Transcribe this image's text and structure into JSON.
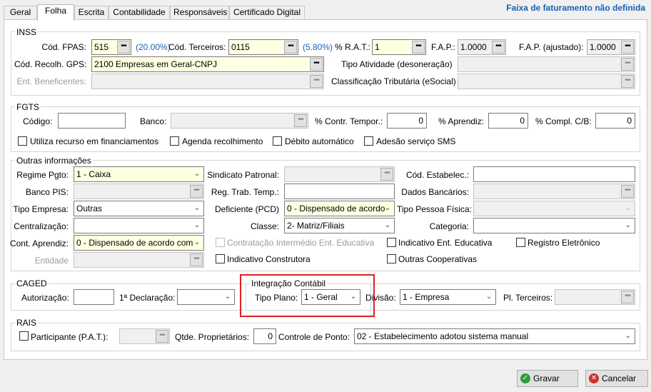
{
  "tabs": [
    "Geral",
    "Folha",
    "Escrita",
    "Contabilidade",
    "Responsáveis",
    "Certificado Digital"
  ],
  "status_title": "Faixa de faturamento não definida",
  "inss": {
    "title": "INSS",
    "fpas_label": "Cód. FPAS:",
    "fpas_value": "515",
    "fpas_pct": "(20.00%)",
    "terceiros_label": "Cód. Terceiros:",
    "terceiros_value": "0115",
    "terceiros_pct": "(5.80%)",
    "rat_label": "% R.A.T.:",
    "rat_value": "1",
    "fap_label": "F.A.P.:",
    "fap_value": "1.0000",
    "fap_aj_label": "F.A.P. (ajustado):",
    "fap_aj_value": "1.0000",
    "gps_label": "Cód. Recolh. GPS:",
    "gps_value": "2100 Empresas em Geral-CNPJ",
    "tipo_atividade_label": "Tipo Atividade (desoneração)",
    "ent_benef_label": "Ent. Beneficentes:",
    "class_trib_label": "Classificação Tributária (eSocial)"
  },
  "fgts": {
    "title": "FGTS",
    "codigo_label": "Código:",
    "banco_label": "Banco:",
    "contr_temp_label": "% Contr. Tempor.:",
    "contr_temp_value": "0",
    "aprendiz_label": "% Aprendiz:",
    "aprendiz_value": "0",
    "compl_label": "% Compl. C/B:",
    "compl_value": "0",
    "cb_financ": "Utiliza recurso em financiamentos",
    "cb_agenda": "Agenda recolhimento",
    "cb_debito": "Débito automático",
    "cb_sms": "Adesão serviço SMS"
  },
  "outras": {
    "title": "Outras informações",
    "regime_label": "Regime Pgto:",
    "regime_value": "1 - Caixa",
    "sindicato_label": "Sindicato Patronal:",
    "estab_label": "Cód. Estabelec.:",
    "banco_pis_label": "Banco PIS:",
    "reg_trab_label": "Reg. Trab. Temp.:",
    "dados_banc_label": "Dados Bancários:",
    "tipo_emp_label": "Tipo Empresa:",
    "tipo_emp_value": "Outras",
    "deficiente_label": "Deficiente (PCD)",
    "deficiente_value": "0 - Dispensado de acordo",
    "tipo_pf_label": "Tipo Pessoa Física:",
    "centr_label": "Centralização:",
    "classe_label": "Classe:",
    "classe_value": "2-  Matriz/Filiais",
    "categoria_label": "Categoria:",
    "cont_aprendiz_label": "Cont. Aprendiz:",
    "cont_aprendiz_value": "0 - Dispensado de acordo com",
    "cb_contr_interm": "Contratação Intermédio Ent. Educativa",
    "cb_ind_ent": "Indicativo Ent. Educativa",
    "cb_reg_eletr": "Registro Eletrônico",
    "entidade_label": "Entidade",
    "cb_ind_constr": "Indicativo Construtora",
    "cb_outras_coop": "Outras Cooperativas"
  },
  "caged": {
    "title": "CAGED",
    "autorizacao_label": "Autorização:",
    "declaracao_label": "1ª Declaração:"
  },
  "integracao": {
    "title": "Integração Contábil",
    "tipo_plano_label": "Tipo Plano:",
    "tipo_plano_value": "1 - Geral",
    "divisao_label": "Divisão:",
    "divisao_value": "1 - Empresa",
    "pl_terceiros_label": "Pl. Terceiros:"
  },
  "rais": {
    "title": "RAIS",
    "cb_pat": "Participante (P.A.T.):",
    "qtde_prop_label": "Qtde. Proprietários:",
    "qtde_prop_value": "0",
    "controle_label": "Controle de Ponto:",
    "controle_value": "02 - Estabelecimento adotou sistema manual"
  },
  "buttons": {
    "gravar": "Gravar",
    "cancelar": "Cancelar"
  },
  "colors": {
    "accent": "#1a5fb4",
    "highlight": "#ffffe1",
    "red_box": "#e02020"
  }
}
